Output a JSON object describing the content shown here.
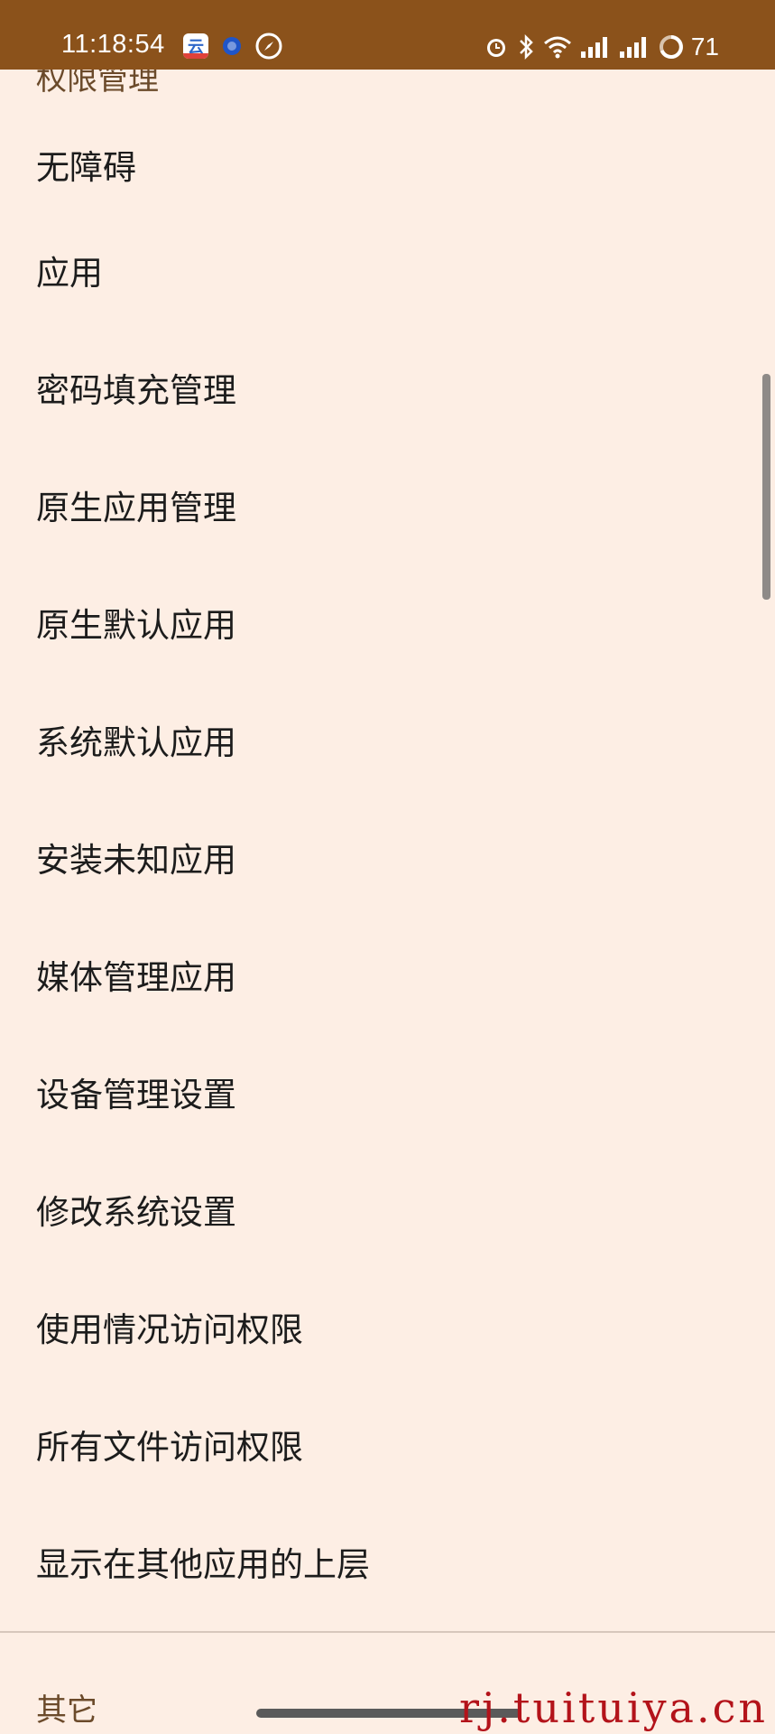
{
  "status_bar": {
    "time": "11:18:54",
    "battery": "71",
    "notification_icons": [
      "cloud-app-icon",
      "blue-dot-icon",
      "compass-icon"
    ],
    "system_icons": [
      "alarm-icon",
      "bluetooth-icon",
      "wifi-icon",
      "signal-icon",
      "signal-icon",
      "battery-ring-icon"
    ]
  },
  "header_partial": "权限管理",
  "menu": [
    {
      "label": "无障碍"
    },
    {
      "label": "应用"
    },
    {
      "label": "密码填充管理"
    },
    {
      "label": "原生应用管理"
    },
    {
      "label": "原生默认应用"
    },
    {
      "label": "系统默认应用"
    },
    {
      "label": "安装未知应用"
    },
    {
      "label": "媒体管理应用"
    },
    {
      "label": "设备管理设置"
    },
    {
      "label": "修改系统设置"
    },
    {
      "label": "使用情况访问权限"
    },
    {
      "label": "所有文件访问权限"
    },
    {
      "label": "显示在其他应用的上层"
    }
  ],
  "footer_partial": "其它",
  "watermark": "rj.tuituiya.cn",
  "colors": {
    "status_bar": "#8b521b",
    "background": "#fdeee4",
    "text": "#1c1c1c",
    "watermark": "#b3131a"
  }
}
